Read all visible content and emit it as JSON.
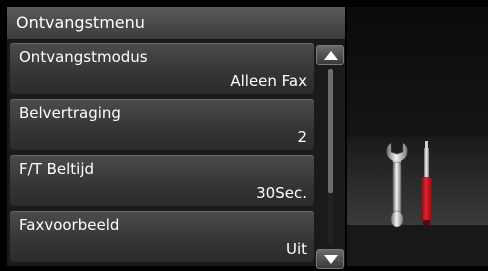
{
  "title": "Ontvangstmenu",
  "items": [
    {
      "label": "Ontvangstmodus",
      "value": "Alleen Fax"
    },
    {
      "label": "Belvertraging",
      "value": "2"
    },
    {
      "label": "F/T Beltijd",
      "value": "30Sec."
    },
    {
      "label": "Faxvoorbeeld",
      "value": "Uit"
    }
  ],
  "scroll": {
    "up_icon": "triangle-up-icon",
    "down_icon": "triangle-down-icon",
    "position": 0
  },
  "settings_icon": "wrench-screwdriver-icon",
  "colors": {
    "screwdriver_handle": "#c0141c"
  }
}
